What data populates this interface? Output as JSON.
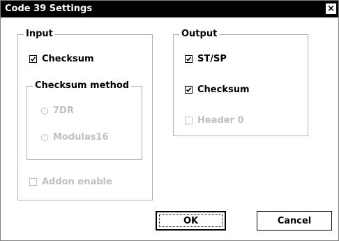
{
  "window": {
    "title": "Code 39 Settings",
    "close_glyph": "×"
  },
  "input_group": {
    "title": "Input",
    "checksum": {
      "label": "Checksum",
      "checked": true
    },
    "method_group": {
      "title": "Checksum method",
      "options": [
        {
          "label": "7DR",
          "selected": false
        },
        {
          "label": "Modulas16",
          "selected": false
        }
      ]
    },
    "addon": {
      "label": "Addon enable",
      "checked": false
    }
  },
  "output_group": {
    "title": "Output",
    "stsp": {
      "label": "ST/SP",
      "checked": true
    },
    "checksum": {
      "label": "Checksum",
      "checked": true
    },
    "header0": {
      "label": "Header 0",
      "checked": false
    }
  },
  "buttons": {
    "ok": "OK",
    "cancel": "Cancel"
  }
}
